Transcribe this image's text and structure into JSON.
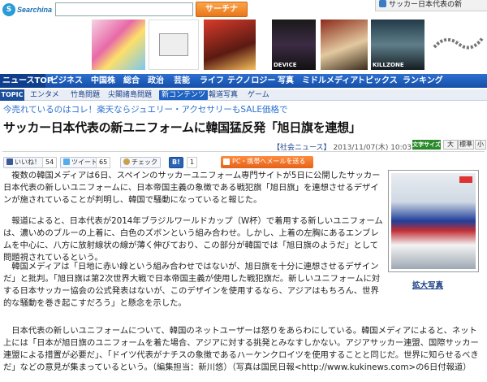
{
  "header": {
    "logo_text": "Searchina",
    "search_button": "サーチナ",
    "search_placeholder": "",
    "browser_tab": "サッカー日本代表の新"
  },
  "banners": [
    {
      "label": ""
    },
    {
      "label": ""
    },
    {
      "label": ""
    },
    {
      "label": "DEVICE"
    },
    {
      "label": ""
    },
    {
      "label": "KILLZONE"
    },
    {
      "label": ""
    }
  ],
  "nav": {
    "items": [
      "ニュースTOP",
      "ビジネス",
      "中国株",
      "総合",
      "政治",
      "芸能",
      "ライフ",
      "テクノロジー",
      "写真",
      "ミドルメディア",
      "トピックス",
      "ランキング"
    ]
  },
  "subnav": {
    "topic": "TOPIC",
    "items": [
      "エンタメ",
      "竹島問題",
      "尖閣諸島問題",
      "新コンテンツ",
      "報道写真",
      "ゲーム"
    ],
    "active_index": 3
  },
  "promo": "今売れているのはコレ！楽天ならジュエリー・アクセサリーもSALE価格で",
  "article": {
    "title": "サッカー日本代表の新ユニフォームに韓国猛反発「旭日旗を連想」",
    "category": "【社会ニュース】",
    "timestamp": "2013/11/07(木) 10:03",
    "text_size_label": "文字サイズ",
    "text_sizes": [
      "大",
      "標準",
      "小"
    ],
    "paragraphs": [
      "複数の韓国メディアは6日、スペインのサッカーユニフォーム専門サイトが5日に公開したサッカー日本代表の新しいユニフォームに、日本帝国主義の象徴である戦犯旗「旭日旗」を連想させるデザインが施されていることが判明し、韓国で騒動になっていると報じた。",
      "報道によると、日本代表が2014年ブラジルワールドカップ（W杯）で着用する新しいユニフォームは、濃いめのブルーの上着に、白色のズボンという組み合わせ。しかし、上着の左胸にあるエンブレムを中心に、八方に放射線状の線が薄く伸びており、この部分が韓国では「旭日旗のようだ」として問題視されているという。",
      "韓国メディアは「日地に赤い線という組み合わせではないが、旭日旗を十分に連想させるデザインだ」と批判。「旭日旗は第2次世界大戦で日本帝国主義が使用した戦犯旗だ。新しいユニフォームに対する日本サッカー協会の公式発表はないが、このデザインを使用するなら、アジアはもちろん、世界的な騒動を巻き起こすだろう」と懸念を示した。",
      "日本代表の新しいユニフォームについて、韓国のネットユーザーは怒りをあらわにしている。韓国メディアによると、ネット上には「日本が旭日旗のユニフォームを着た場合、アジアに対する挑発とみなすしかない。アジアサッカー連盟、国際サッカー連盟による措置が必要だ」、「ドイツ代表がナチスの象徴であるハーケンクロイツを使用することと同じだ。世界に知らせるべきだ」などの意見が集まっているという。（編集担当：新川悠）（写真は国民日報<http://www.kukinews.com>の6日付報道）"
    ],
    "photo_caption": "拡大写真"
  },
  "social": {
    "like_label": "いいね！",
    "like_count": "54",
    "tweet_label": "ツイート",
    "tweet_count": "65",
    "check_label": "チェック",
    "hatena_label": "B!",
    "hatena_count": "1",
    "mail_label": "PC・携帯へメールを送る"
  }
}
